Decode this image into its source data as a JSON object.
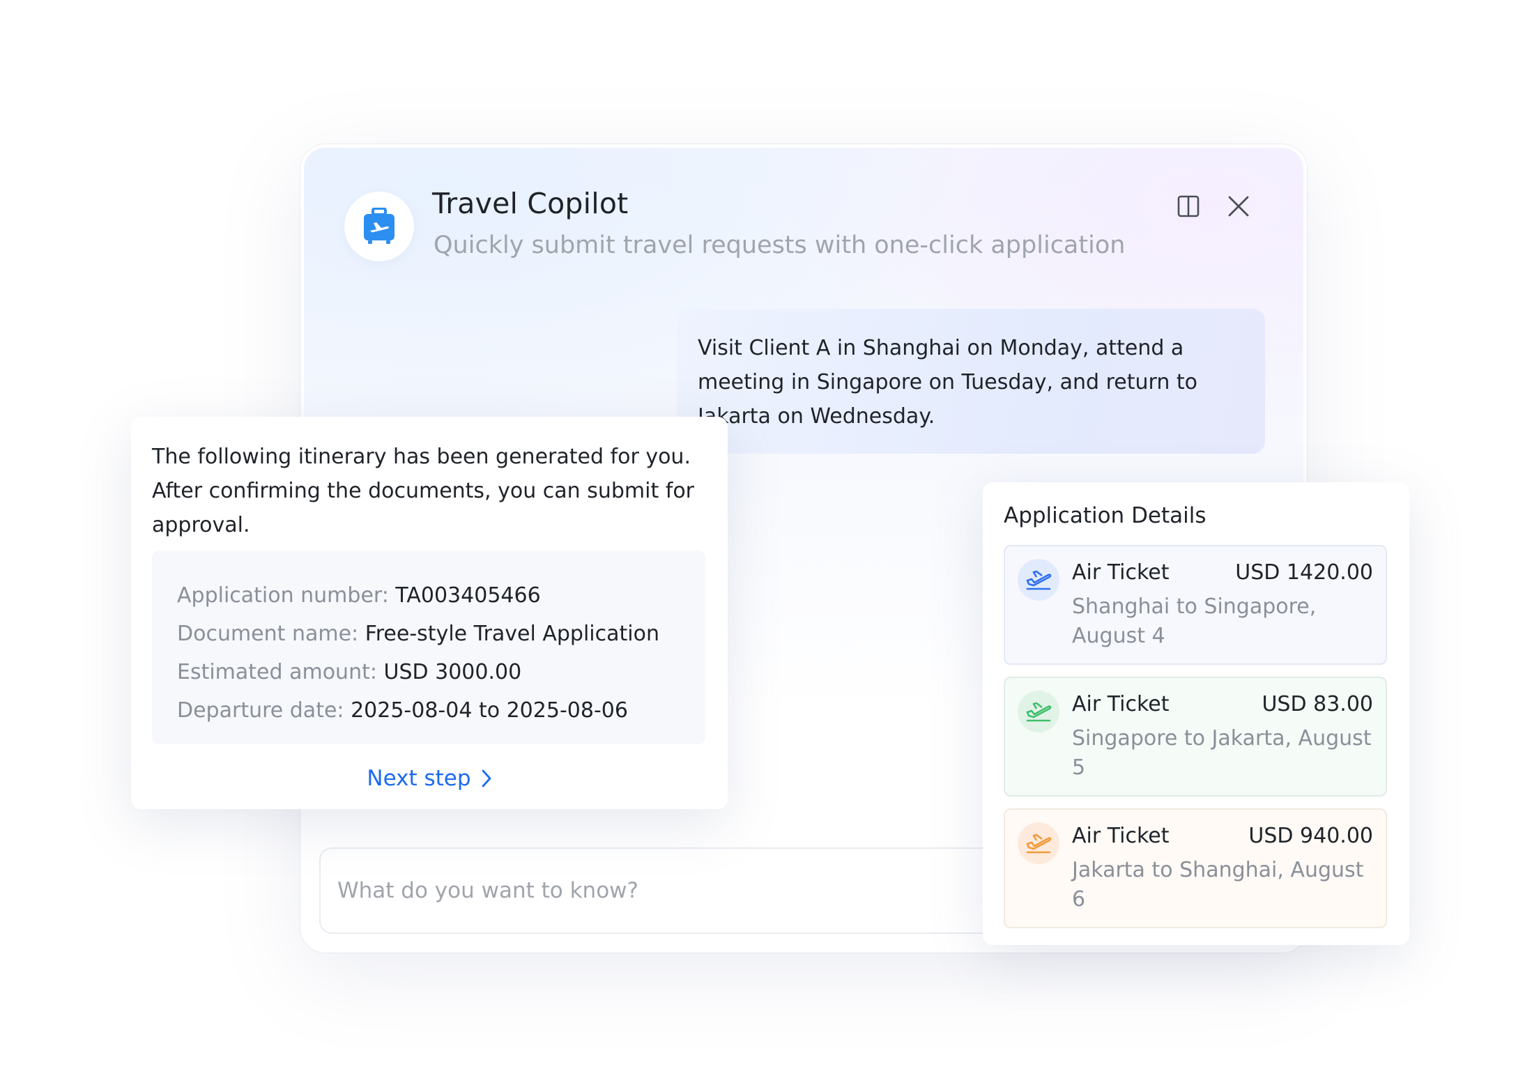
{
  "app": {
    "title": "Travel Copilot",
    "subtitle": "Quickly submit travel requests with one-click application",
    "icon": "suitcase-plane-icon",
    "accent_color": "#2b8ef0"
  },
  "window_controls": {
    "split_icon": "split-panel-icon",
    "close_icon": "close-icon"
  },
  "user_message": "Visit Client A in Shanghai on Monday, attend a meeting in Singapore on Tuesday, and return to Jakarta on Wednesday.",
  "itinerary": {
    "message": "The following itinerary has been generated for you. After confirming the documents, you can submit for approval.",
    "details": [
      {
        "label": "Application number: ",
        "value": "TA003405466"
      },
      {
        "label": "Document name: ",
        "value": "Free-style Travel Application"
      },
      {
        "label": "Estimated amount: ",
        "value": "USD 3000.00"
      },
      {
        "label": "Departure date: ",
        "value": "2025-08-04 to 2025-08-06"
      }
    ],
    "next_step_label": "Next step",
    "link_color": "#1c6af2"
  },
  "application_details": {
    "title": "Application Details",
    "tickets": [
      {
        "type": "Air Ticket",
        "amount": "USD 1420.00",
        "route": "Shanghai to Singapore, August 4",
        "icon": "plane-icon",
        "color": "#2f6ff0"
      },
      {
        "type": "Air Ticket",
        "amount": "USD 83.00",
        "route": "Singapore to Jakarta, August 5",
        "icon": "plane-icon",
        "color": "#3fbf6a"
      },
      {
        "type": "Air Ticket",
        "amount": "USD 940.00",
        "route": "Jakarta to Shanghai, August 6",
        "icon": "plane-icon",
        "color": "#f39a3c"
      }
    ]
  },
  "chat_input": {
    "placeholder": "What do you want to know?",
    "value": ""
  }
}
